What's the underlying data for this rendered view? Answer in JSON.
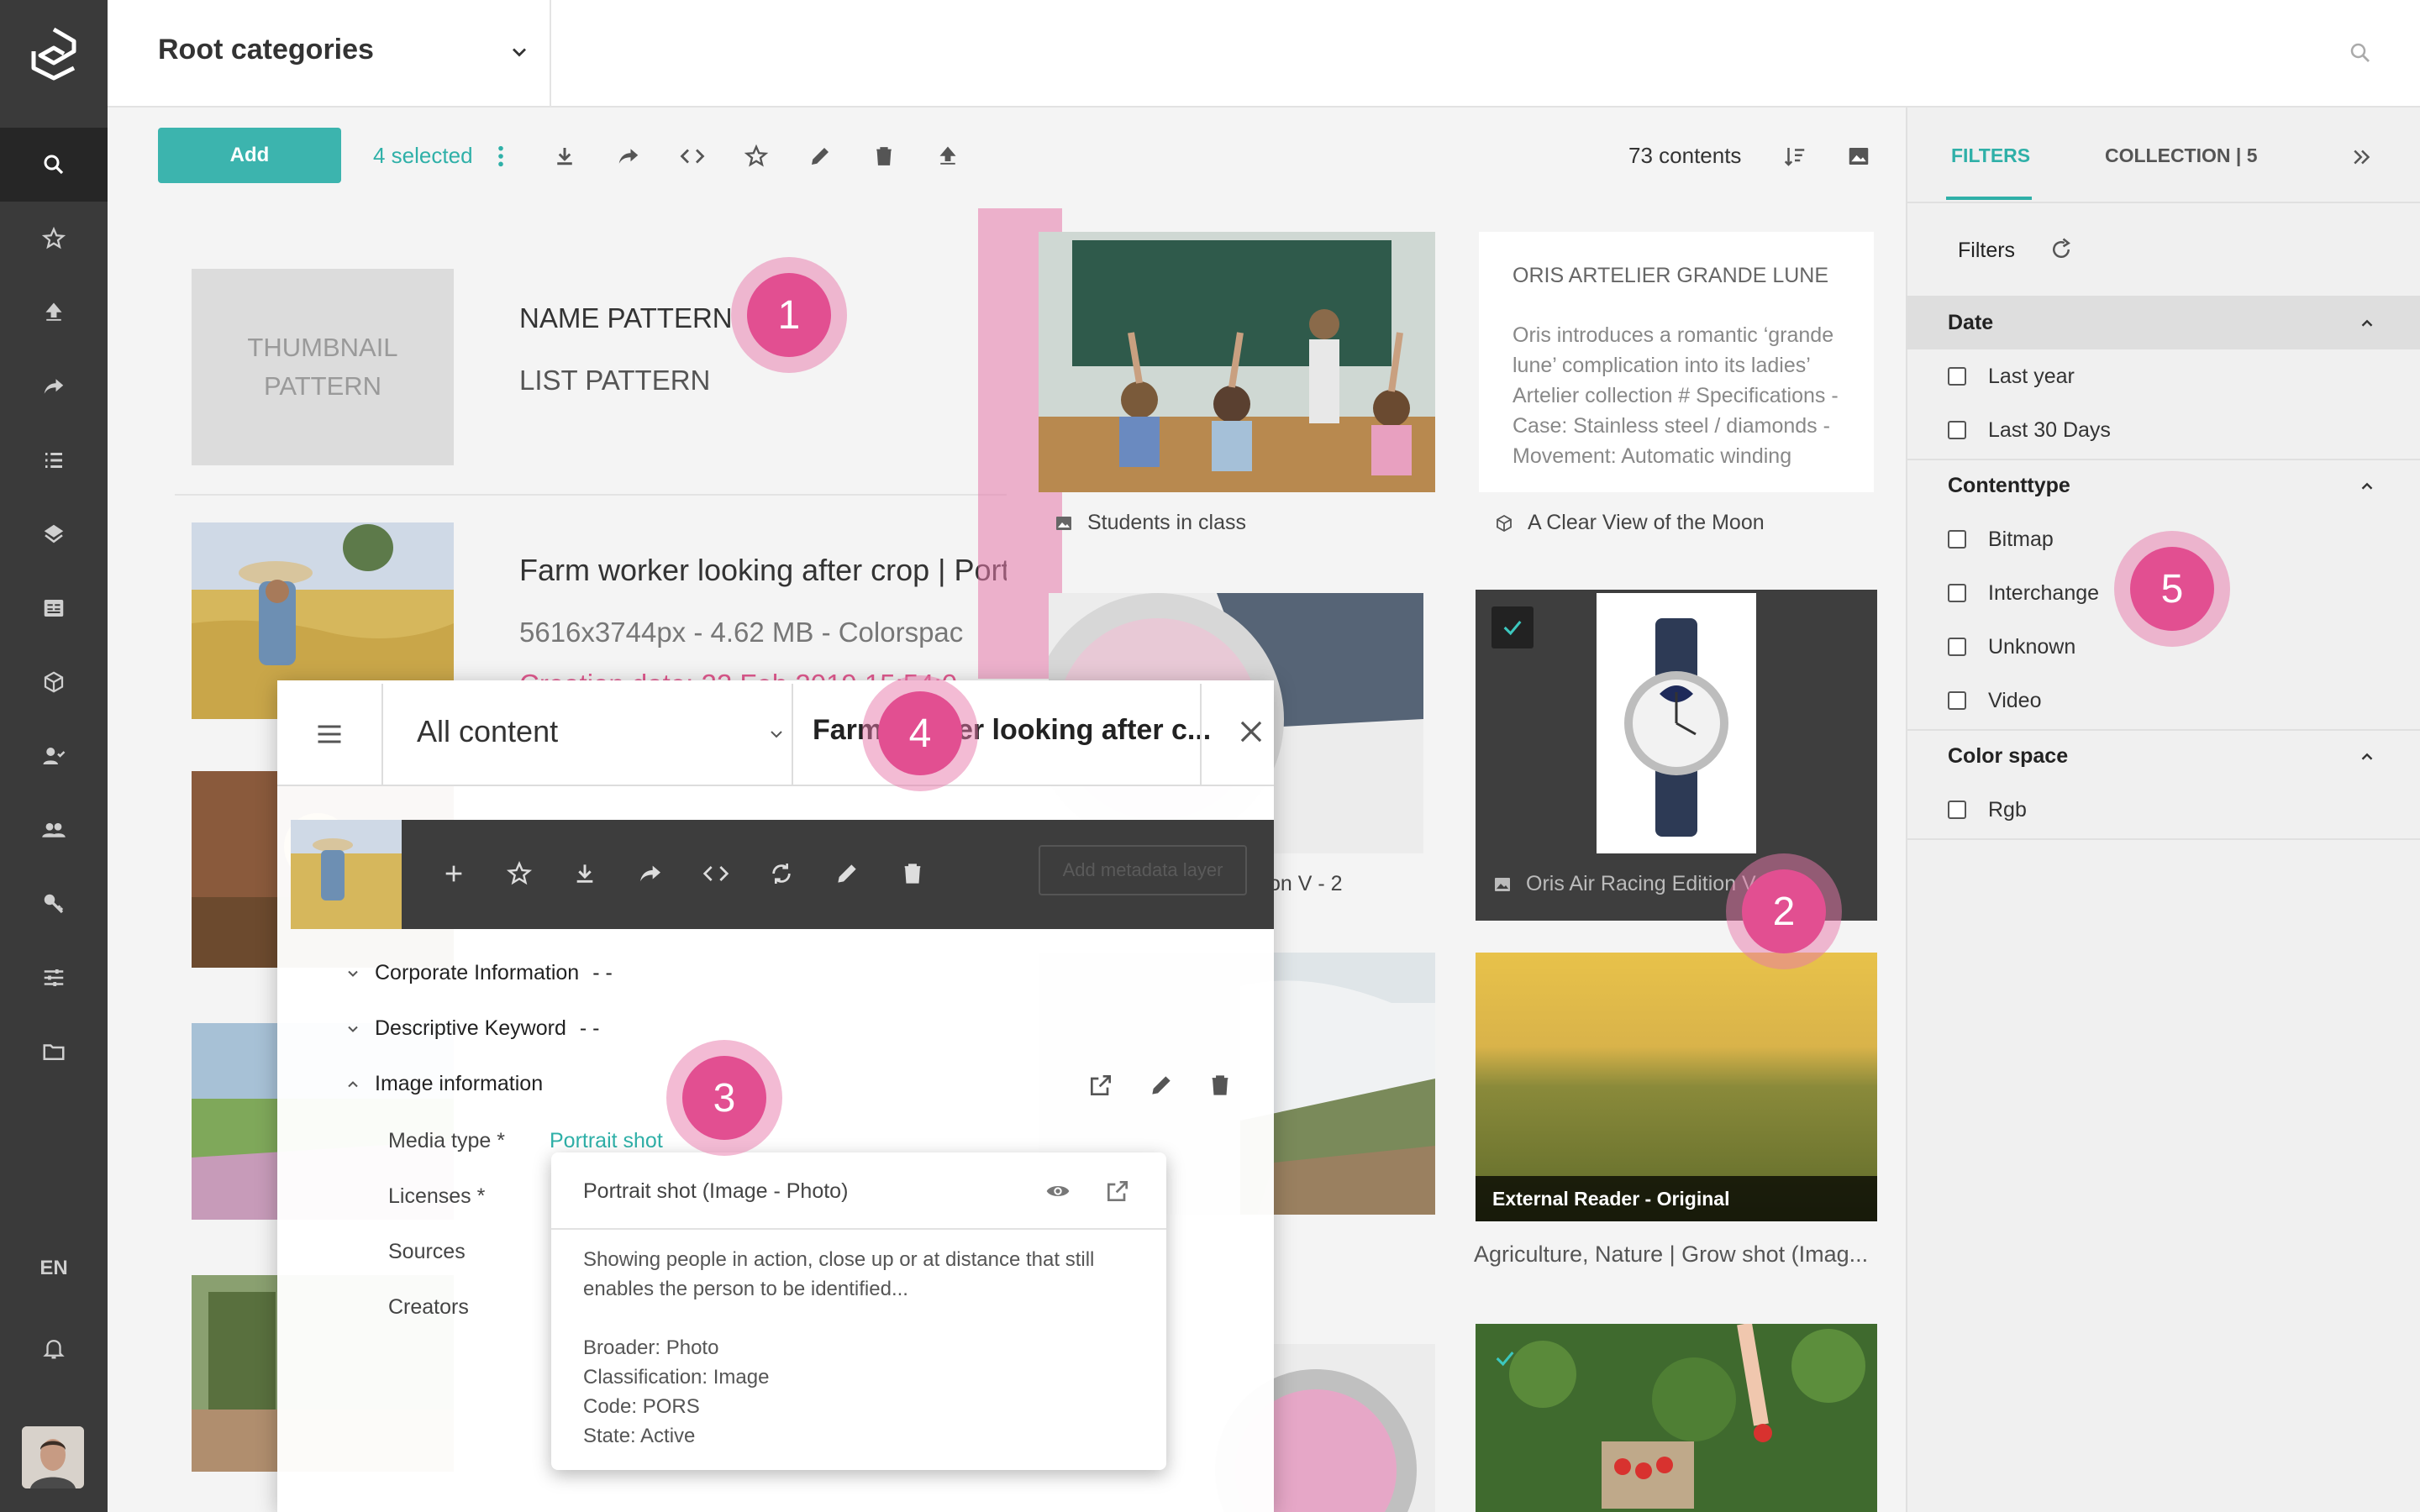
{
  "nav": {
    "language": "EN",
    "items": [
      "search-icon",
      "star-icon",
      "upload-icon",
      "share-icon",
      "list-icon",
      "layers-icon",
      "news-icon",
      "box-icon",
      "user-check-icon",
      "users-icon",
      "key-icon",
      "sliders-icon",
      "folder-icon"
    ]
  },
  "header": {
    "category_select": "Root categories"
  },
  "toolbar": {
    "add_label": "Add",
    "selected_label": "4 selected",
    "content_count": "73 contents"
  },
  "list": {
    "thumbnail_pattern": "THUMBNAIL PATTERN",
    "name_pattern": "NAME PATTERN",
    "list_pattern": "LIST PATTERN",
    "row1_title": "Farm worker looking after crop | Port",
    "row1_meta": "5616x3744px - 4.62 MB - Colorspac",
    "row1_date": "Creation date: 22 Feb 2019 15:54:0"
  },
  "grid": {
    "card1_label": "Students in class",
    "card2_title": "ORIS ARTELIER GRANDE LUNE",
    "card2_body": "Oris introduces a romantic ‘grande lune’ complication into its ladies’ Artelier collection # Specifications - Case: Stainless steel / diamonds - Movement: Automatic winding",
    "card2_label": "A Clear View of the Moon",
    "card3_label_suffix": "on V - 2",
    "card4_label": "Oris Air Racing Edition V",
    "card6_ribbon": "External Reader - Original",
    "card6_label": "Agriculture, Nature | Grow shot (Imag..."
  },
  "detail": {
    "channel_select": "All content",
    "title": "Farm worker looking after c...",
    "ghost_button": "Add metadata layer",
    "sections": [
      {
        "label": "Corporate Information",
        "value": "- -"
      },
      {
        "label": "Descriptive Keyword",
        "value": "- -"
      },
      {
        "label": "Image information",
        "value": ""
      }
    ],
    "fields": {
      "media_type_label": "Media type *",
      "media_type_value": "Portrait shot",
      "licenses_label": "Licenses *",
      "sources_label": "Sources",
      "creators_label": "Creators"
    },
    "tooltip": {
      "title": "Portrait shot (Image - Photo)",
      "description": "Showing people in action, close up or at distance that still enables the person to be identified...",
      "broader": "Broader: Photo",
      "classification": "Classification: Image",
      "code": "Code: PORS",
      "state": "State: Active"
    }
  },
  "filters": {
    "tab_filters": "FILTERS",
    "tab_collection": "COLLECTION | 5",
    "heading": "Filters",
    "groups": [
      {
        "title": "Date",
        "options": [
          "Last year",
          "Last 30 Days"
        ]
      },
      {
        "title": "Contenttype",
        "options": [
          "Bitmap",
          "Interchange",
          "Unknown",
          "Video"
        ]
      },
      {
        "title": "Color space",
        "options": [
          "Rgb"
        ]
      }
    ]
  },
  "badges": [
    "1",
    "2",
    "3",
    "4",
    "5"
  ],
  "colors": {
    "accent": "#2fb0a8",
    "badge": "#e24f91",
    "nav_bg": "#3a3a3a"
  }
}
